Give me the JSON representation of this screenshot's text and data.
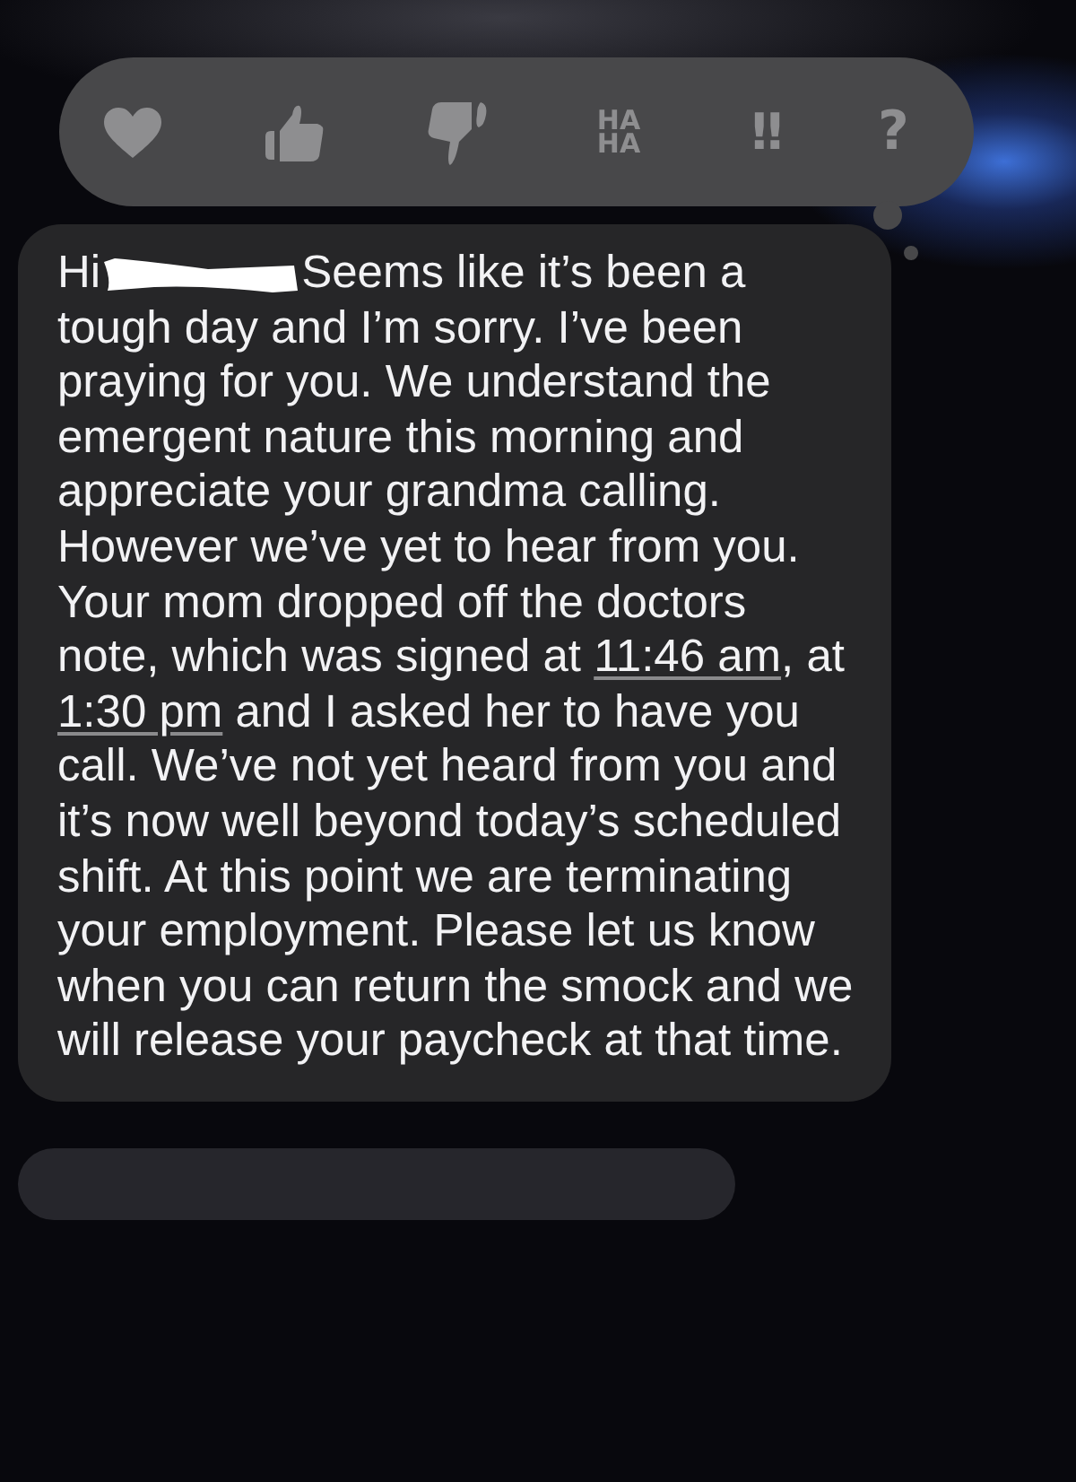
{
  "tapback_bar": {
    "reactions": [
      {
        "kind": "heart"
      },
      {
        "kind": "thumbs-up"
      },
      {
        "kind": "thumbs-down"
      },
      {
        "kind": "text",
        "label": "HA HA"
      },
      {
        "kind": "text",
        "label": "!!"
      },
      {
        "kind": "text",
        "label": "?"
      }
    ]
  },
  "message": {
    "segments": [
      {
        "kind": "text",
        "text": "Hi"
      },
      {
        "kind": "redaction"
      },
      {
        "kind": "text",
        "text": "Seems like it’s been a tough day and I’m sorry. I’ve been praying for you. We understand the emergent nature this morning and appreciate your grandma calling. However we’ve yet to hear from you. Your mom dropped off the doctors note, which was signed at "
      },
      {
        "kind": "link",
        "text": "11:46 am"
      },
      {
        "kind": "text",
        "text": ", at "
      },
      {
        "kind": "link",
        "text": "1:30 pm"
      },
      {
        "kind": "text",
        "text": " and I asked her to have you call. We’ve not yet heard from you and it’s now well beyond today’s scheduled shift. At this point we are terminating your employment. Please let us know when you can return the smock and we will release your paycheck at that time."
      }
    ]
  }
}
